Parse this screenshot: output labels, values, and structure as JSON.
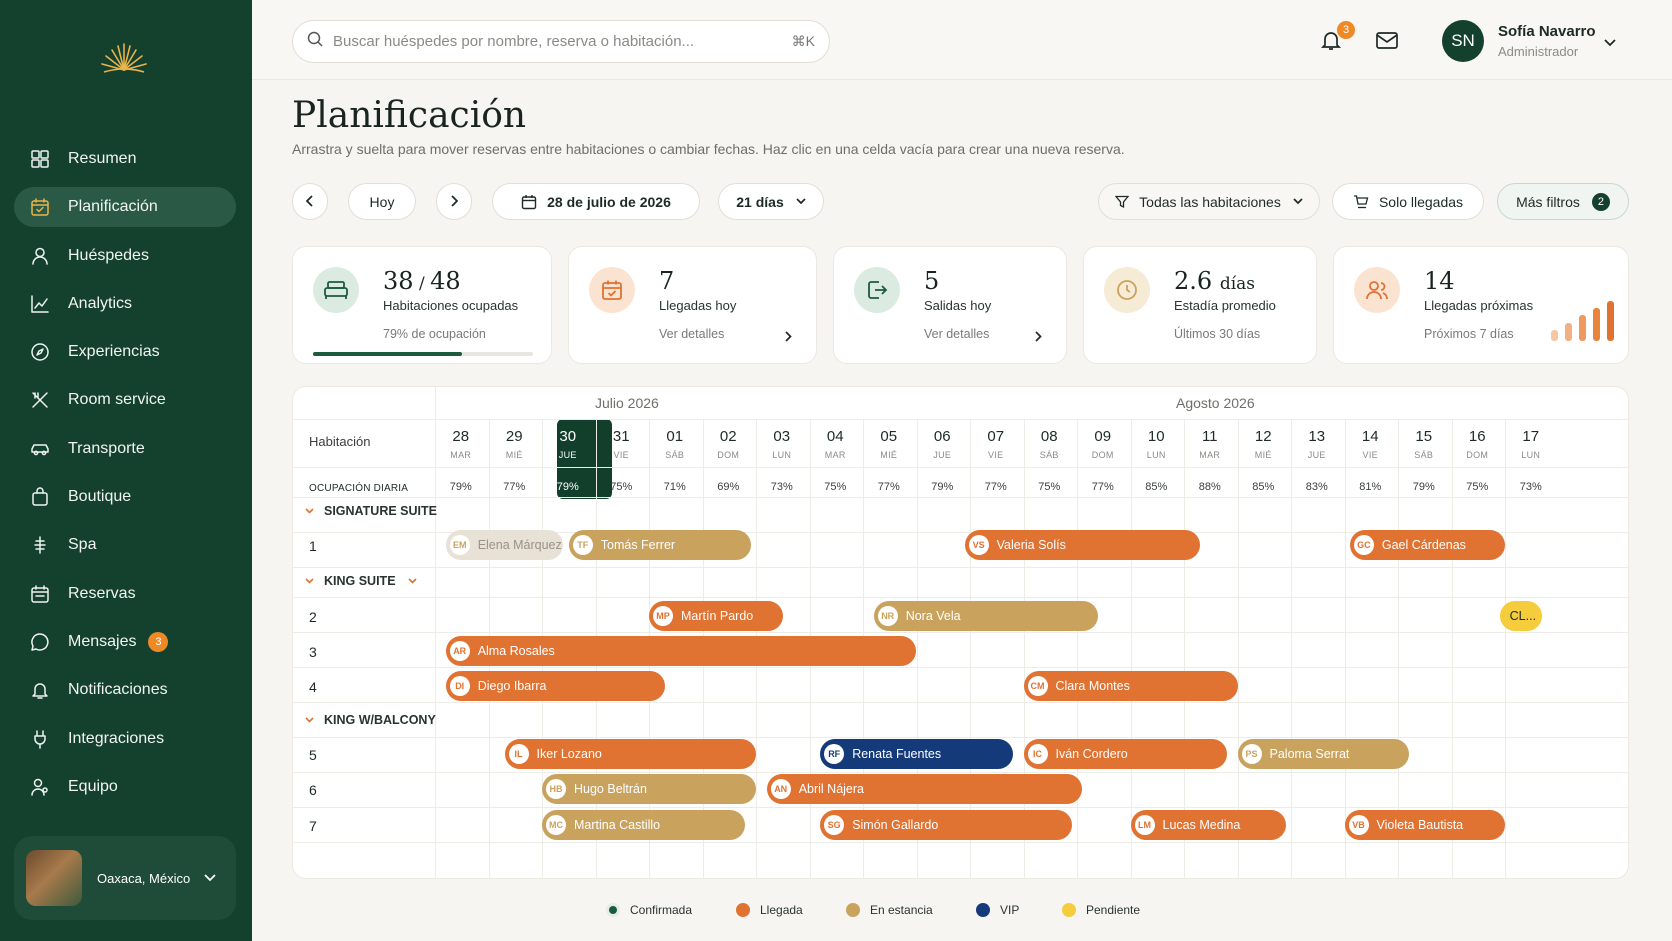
{
  "sidebar": {
    "items": [
      {
        "label": "Resumen",
        "icon": "grid-icon"
      },
      {
        "label": "Planificación",
        "icon": "calendar-icon",
        "active": true
      },
      {
        "label": "Huéspedes",
        "icon": "user-icon"
      },
      {
        "label": "Analytics",
        "icon": "chart-icon"
      },
      {
        "label": "Experiencias",
        "icon": "compass-icon"
      },
      {
        "label": "Room service",
        "icon": "utensils-icon"
      },
      {
        "label": "Transporte",
        "icon": "car-icon"
      },
      {
        "label": "Boutique",
        "icon": "bag-icon"
      },
      {
        "label": "Spa",
        "icon": "spa-icon"
      },
      {
        "label": "Reservas",
        "icon": "calendar-check-icon"
      },
      {
        "label": "Mensajes",
        "icon": "chat-icon",
        "badge": "3"
      },
      {
        "label": "Notificaciones",
        "icon": "bell-icon"
      },
      {
        "label": "Integraciones",
        "icon": "plug-icon"
      },
      {
        "label": "Equipo",
        "icon": "team-icon"
      }
    ],
    "location": "Oaxaca, México"
  },
  "header": {
    "search_placeholder": "Buscar huéspedes por nombre, reserva o habitación...",
    "search_shortcut": "⌘K",
    "notifications_count": "3",
    "user_initials": "SN",
    "user_name": "Sofía Navarro",
    "user_role": "Administrador"
  },
  "page": {
    "title": "Planificación",
    "subtitle": "Arrastra y suelta para mover reservas entre habitaciones o cambiar fechas. Haz clic en una celda vacía para crear una nueva reserva."
  },
  "toolbar": {
    "today": "Hoy",
    "date": "28 de julio de 2026",
    "range": "21 días",
    "rooms_filter": "Todas las habitaciones",
    "arrivals_only": "Solo llegadas",
    "more_filters": "Más filtros",
    "more_filters_count": "2"
  },
  "stats": [
    {
      "value_a": "38",
      "value_b": "48",
      "label": "Habitaciones ocupadas",
      "sub": "79% de ocupación",
      "occupancy": 0.79
    },
    {
      "value": "7",
      "label": "Llegadas hoy",
      "sub": "Ver detalles"
    },
    {
      "value": "5",
      "label": "Salidas hoy",
      "sub": "Ver detalles"
    },
    {
      "value": "2.6",
      "unit": "días",
      "label": "Estadía promedio",
      "sub": "Últimos 30 días"
    },
    {
      "value": "14",
      "label": "Llegadas próximas",
      "sub": "Próximos 7 días"
    }
  ],
  "calendar": {
    "months": [
      "Julio 2026",
      "Agosto 2026"
    ],
    "room_header": "Habitación",
    "occupancy_label": "OCUPACIÓN DIARIA",
    "days": [
      {
        "d": "28",
        "w": "MAR",
        "o": "79%"
      },
      {
        "d": "29",
        "w": "MIÉ",
        "o": "77%"
      },
      {
        "d": "30",
        "w": "JUE",
        "o": "79%",
        "today": true
      },
      {
        "d": "31",
        "w": "VIE",
        "o": "75%"
      },
      {
        "d": "01",
        "w": "SÁB",
        "o": "71%"
      },
      {
        "d": "02",
        "w": "DOM",
        "o": "69%"
      },
      {
        "d": "03",
        "w": "LUN",
        "o": "73%"
      },
      {
        "d": "04",
        "w": "MAR",
        "o": "75%"
      },
      {
        "d": "05",
        "w": "MIÉ",
        "o": "77%"
      },
      {
        "d": "06",
        "w": "JUE",
        "o": "79%"
      },
      {
        "d": "07",
        "w": "VIE",
        "o": "77%"
      },
      {
        "d": "08",
        "w": "SÁB",
        "o": "75%"
      },
      {
        "d": "09",
        "w": "DOM",
        "o": "77%"
      },
      {
        "d": "10",
        "w": "LUN",
        "o": "85%"
      },
      {
        "d": "11",
        "w": "MAR",
        "o": "88%"
      },
      {
        "d": "12",
        "w": "MIÉ",
        "o": "85%"
      },
      {
        "d": "13",
        "w": "JUE",
        "o": "83%"
      },
      {
        "d": "14",
        "w": "VIE",
        "o": "81%"
      },
      {
        "d": "15",
        "w": "SÁB",
        "o": "79%"
      },
      {
        "d": "16",
        "w": "DOM",
        "o": "75%"
      },
      {
        "d": "17",
        "w": "LUN",
        "o": "73%"
      }
    ],
    "groups": [
      {
        "name": "SIGNATURE SUITE",
        "rooms": [
          "1"
        ]
      },
      {
        "name": "KING SUITE",
        "rooms": [
          "2",
          "3",
          "4"
        ]
      },
      {
        "name": "KING W/BALCONY",
        "rooms": [
          "5",
          "6",
          "7"
        ]
      }
    ],
    "bookings": [
      {
        "room": "1",
        "ini": "EM",
        "name": "Elena Márquez",
        "status": "past"
      },
      {
        "room": "1",
        "ini": "TF",
        "name": "Tomás Ferrer",
        "status": "stay"
      },
      {
        "room": "1",
        "ini": "VS",
        "name": "Valeria Solís",
        "status": "arrival"
      },
      {
        "room": "1",
        "ini": "GC",
        "name": "Gael Cárdenas",
        "status": "arrival"
      },
      {
        "room": "2",
        "ini": "MP",
        "name": "Martín Pardo",
        "status": "arrival"
      },
      {
        "room": "2",
        "ini": "NR",
        "name": "Nora Vela",
        "status": "stay"
      },
      {
        "room": "2",
        "ini": "",
        "name": "CL...",
        "status": "pending"
      },
      {
        "room": "3",
        "ini": "AR",
        "name": "Alma Rosales",
        "status": "arrival"
      },
      {
        "room": "4",
        "ini": "DI",
        "name": "Diego Ibarra",
        "status": "arrival"
      },
      {
        "room": "4",
        "ini": "CM",
        "name": "Clara Montes",
        "status": "arrival"
      },
      {
        "room": "5",
        "ini": "IL",
        "name": "Iker Lozano",
        "status": "arrival"
      },
      {
        "room": "5",
        "ini": "RF",
        "name": "Renata Fuentes",
        "status": "vip"
      },
      {
        "room": "5",
        "ini": "IC",
        "name": "Iván Cordero",
        "status": "arrival"
      },
      {
        "room": "5",
        "ini": "PS",
        "name": "Paloma Serrat",
        "status": "stay"
      },
      {
        "room": "6",
        "ini": "HB",
        "name": "Hugo Beltrán",
        "status": "stay"
      },
      {
        "room": "6",
        "ini": "AN",
        "name": "Abril Nájera",
        "status": "arrival"
      },
      {
        "room": "7",
        "ini": "MC",
        "name": "Martina Castillo",
        "status": "stay"
      },
      {
        "room": "7",
        "ini": "SG",
        "name": "Simón Gallardo",
        "status": "arrival"
      },
      {
        "room": "7",
        "ini": "LM",
        "name": "Lucas Medina",
        "status": "arrival"
      },
      {
        "room": "7",
        "ini": "VB",
        "name": "Violeta Bautista",
        "status": "arrival"
      }
    ]
  },
  "legend": [
    {
      "label": "Confirmada",
      "color": "#1c5a3e"
    },
    {
      "label": "Llegada",
      "color": "#e07232"
    },
    {
      "label": "En estancia",
      "color": "#c9a25e"
    },
    {
      "label": "VIP",
      "color": "#143a7a"
    },
    {
      "label": "Pendiente",
      "color": "#f5cc3c"
    }
  ],
  "colors": {
    "sidebar": "#14402e",
    "arrival": "#e07232",
    "stay": "#c9a25e",
    "vip": "#143a7a",
    "pending": "#f5cc3c",
    "past": "#e8e1d6"
  }
}
